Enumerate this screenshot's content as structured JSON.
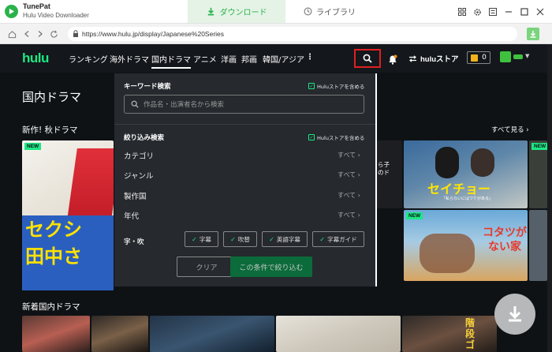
{
  "app": {
    "name": "TunePat",
    "subtitle": "Hulu Video Downloader"
  },
  "tabs": {
    "download": "ダウンロード",
    "library": "ライブラリ"
  },
  "browser": {
    "url": "https://www.hulu.jp/display/Japanese%20Series"
  },
  "nav": {
    "logo": "hulu",
    "items": [
      "ランキング",
      "海外ドラマ",
      "国内ドラマ",
      "アニメ",
      "洋画",
      "邦画",
      "韓国/アジア"
    ],
    "store": "huluストア",
    "points": "0"
  },
  "page": {
    "title": "国内ドラマ",
    "section1": "新作! 秋ドラマ",
    "see_all": "すべて見る",
    "section2": "新着国内ドラマ",
    "new_badge": "NEW"
  },
  "thumbs": {
    "t1": "セクシ\n田中さ",
    "t2": "セイチョー",
    "t2_sub": "「私らないにはワケがある」",
    "t3": "コタツが\nない家",
    "t4": "階\n段\nゴ",
    "partial_text": "ら子\nのド"
  },
  "search_panel": {
    "keyword_title": "キーワード検索",
    "include_store": "Huluストアを含める",
    "placeholder": "作品名・出演者名から検索",
    "filter_title": "絞り込み検索",
    "rows": [
      {
        "label": "カテゴリ",
        "value": "すべて"
      },
      {
        "label": "ジャンル",
        "value": "すべて"
      },
      {
        "label": "製作国",
        "value": "すべて"
      },
      {
        "label": "年代",
        "value": "すべて"
      }
    ],
    "subtitle_label": "字・吹",
    "tags": [
      "字幕",
      "吹替",
      "英語字幕",
      "字幕ガイド"
    ],
    "clear": "クリア",
    "apply": "この条件で絞り込む"
  },
  "colors": {
    "accent": "#2bb24c",
    "hulu_green": "#1ce783",
    "highlight": "#e02020"
  }
}
